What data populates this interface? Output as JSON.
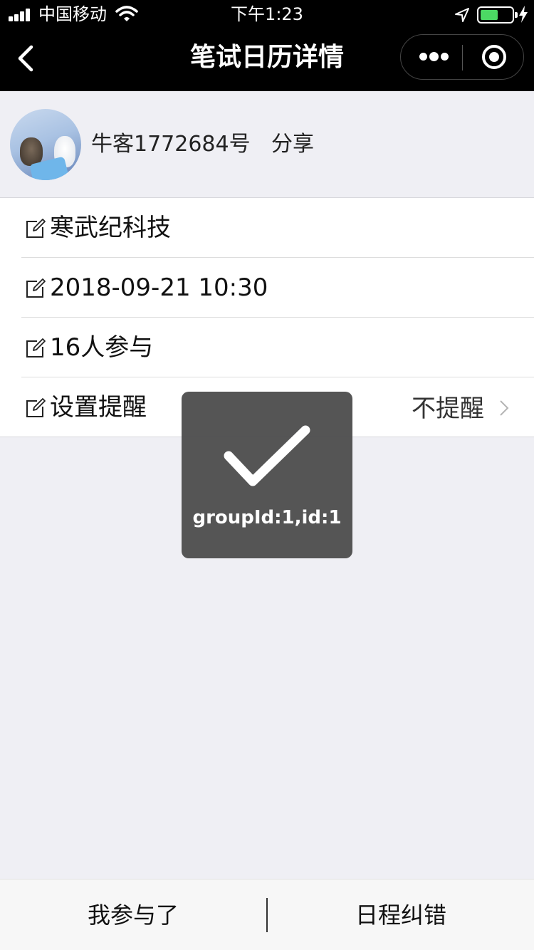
{
  "status_bar": {
    "carrier": "中国移动",
    "time": "下午1:23"
  },
  "nav": {
    "title": "笔试日历详情"
  },
  "profile": {
    "name": "牛客1772684号",
    "share_label": "分享"
  },
  "details": {
    "items": [
      {
        "label": "寒武纪科技",
        "value": ""
      },
      {
        "label": "2018-09-21 10:30",
        "value": ""
      },
      {
        "label": "16人参与",
        "value": ""
      },
      {
        "label": "设置提醒",
        "value": "不提醒"
      }
    ]
  },
  "toast": {
    "message": "groupId:1,id:1",
    "icon": "checkmark-icon"
  },
  "bottom_bar": {
    "left_label": "我参与了",
    "right_label": "日程纠错"
  },
  "colors": {
    "nav_background": "#000000",
    "page_background": "#efeff4",
    "battery_fill": "#4cd964",
    "toast_background": "#4c4c4c"
  }
}
